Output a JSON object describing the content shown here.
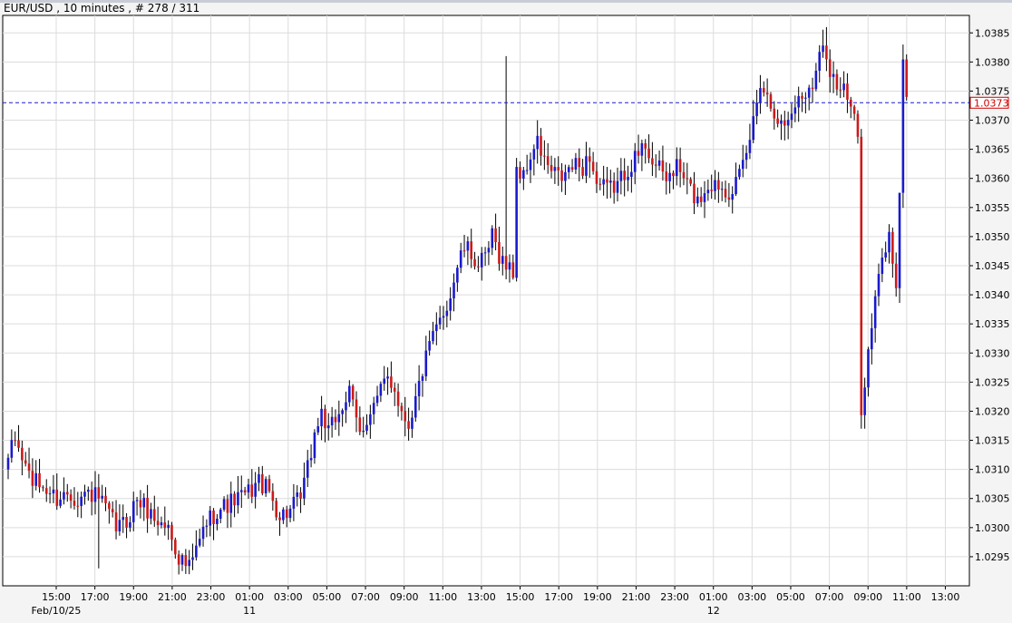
{
  "chart_data": {
    "type": "candlestick",
    "title": "EUR/USD , 10 minutes , # 278 / 311",
    "symbol": "EUR/USD",
    "timeframe": "10 minutes",
    "bar_index": "# 278 / 311",
    "ylim": [
      1.029,
      1.0388
    ],
    "yticks": [
      "1.0385",
      "1.0380",
      "1.0375",
      "1.0370",
      "1.0365",
      "1.0360",
      "1.0355",
      "1.0350",
      "1.0345",
      "1.0340",
      "1.0335",
      "1.0330",
      "1.0325",
      "1.0320",
      "1.0315",
      "1.0310",
      "1.0305",
      "1.0300",
      "1.0295"
    ],
    "xticks": [
      "15:00",
      "17:00",
      "19:00",
      "21:00",
      "23:00",
      "01:00",
      "03:00",
      "05:00",
      "07:00",
      "09:00",
      "11:00",
      "13:00",
      "15:00",
      "17:00",
      "19:00",
      "21:00",
      "23:00",
      "01:00",
      "03:00",
      "05:00",
      "07:00",
      "09:00",
      "11:00",
      "13:00"
    ],
    "date_labels": [
      {
        "label": "Feb/10/25",
        "at_tick": 0
      },
      {
        "label": "11",
        "at_tick": 5
      },
      {
        "label": "12",
        "at_tick": 17
      }
    ],
    "current_price": 1.0373,
    "current_price_label": "1.0373",
    "grid": true,
    "colors": {
      "up": "#1a1acc",
      "down": "#cc1a1a",
      "wick": "#000000",
      "grid": "#dcdcdc",
      "price_line": "#1a1acc",
      "price_label": "#cc0000"
    },
    "anchor_closes": [
      [
        0,
        1.0312
      ],
      [
        2,
        1.0315
      ],
      [
        4,
        1.0312
      ],
      [
        7,
        1.0308
      ],
      [
        10,
        1.0307
      ],
      [
        14,
        1.0305
      ],
      [
        17,
        1.0306
      ],
      [
        20,
        1.0305
      ],
      [
        23,
        1.0306
      ],
      [
        26,
        1.0305
      ],
      [
        29,
        1.0302
      ],
      [
        31,
        1.03
      ],
      [
        34,
        1.0301
      ],
      [
        37,
        1.0305
      ],
      [
        40,
        1.0303
      ],
      [
        43,
        1.0301
      ],
      [
        46,
        1.03
      ],
      [
        49,
        1.0295
      ],
      [
        52,
        1.0293
      ],
      [
        54,
        1.0296
      ],
      [
        57,
        1.0301
      ],
      [
        60,
        1.0303
      ],
      [
        63,
        1.0304
      ],
      [
        66,
        1.0305
      ],
      [
        69,
        1.0306
      ],
      [
        72,
        1.0308
      ],
      [
        75,
        1.0306
      ],
      [
        78,
        1.0302
      ],
      [
        81,
        1.0303
      ],
      [
        84,
        1.0305
      ],
      [
        86,
        1.031
      ],
      [
        88,
        1.0316
      ],
      [
        90,
        1.032
      ],
      [
        92,
        1.0316
      ],
      [
        95,
        1.032
      ],
      [
        98,
        1.0323
      ],
      [
        101,
        1.0316
      ],
      [
        103,
        1.0319
      ],
      [
        106,
        1.0322
      ],
      [
        109,
        1.0326
      ],
      [
        111,
        1.0324
      ],
      [
        113,
        1.032
      ],
      [
        115,
        1.0318
      ],
      [
        117,
        1.0322
      ],
      [
        119,
        1.0327
      ],
      [
        121,
        1.0331
      ],
      [
        123,
        1.0334
      ],
      [
        125,
        1.0337
      ],
      [
        127,
        1.034
      ],
      [
        129,
        1.0345
      ],
      [
        131,
        1.0348
      ],
      [
        133,
        1.0347
      ],
      [
        135,
        1.0345
      ],
      [
        137,
        1.0346
      ],
      [
        139,
        1.035
      ],
      [
        141,
        1.0347
      ],
      [
        143,
        1.0345
      ],
      [
        145,
        1.0344
      ],
      [
        146,
        1.0362
      ],
      [
        148,
        1.036
      ],
      [
        150,
        1.0364
      ],
      [
        152,
        1.0366
      ],
      [
        154,
        1.0363
      ],
      [
        156,
        1.0361
      ],
      [
        159,
        1.036
      ],
      [
        162,
        1.0362
      ],
      [
        165,
        1.0362
      ],
      [
        167,
        1.0364
      ],
      [
        169,
        1.0359
      ],
      [
        172,
        1.0358
      ],
      [
        175,
        1.0359
      ],
      [
        178,
        1.0362
      ],
      [
        181,
        1.0364
      ],
      [
        183,
        1.0366
      ],
      [
        186,
        1.0362
      ],
      [
        189,
        1.036
      ],
      [
        192,
        1.0362
      ],
      [
        195,
        1.0359
      ],
      [
        198,
        1.0356
      ],
      [
        201,
        1.0359
      ],
      [
        204,
        1.0359
      ],
      [
        207,
        1.0358
      ],
      [
        210,
        1.036
      ],
      [
        212,
        1.0364
      ],
      [
        214,
        1.037
      ],
      [
        216,
        1.0377
      ],
      [
        218,
        1.0374
      ],
      [
        220,
        1.0372
      ],
      [
        222,
        1.0369
      ],
      [
        224,
        1.037
      ],
      [
        226,
        1.0373
      ],
      [
        228,
        1.0374
      ],
      [
        230,
        1.0376
      ],
      [
        232,
        1.0378
      ],
      [
        234,
        1.0384
      ],
      [
        236,
        1.0379
      ],
      [
        238,
        1.0376
      ],
      [
        240,
        1.0375
      ],
      [
        242,
        1.0372
      ],
      [
        244,
        1.0367
      ],
      [
        245,
        1.0321
      ],
      [
        247,
        1.033
      ],
      [
        249,
        1.0339
      ],
      [
        251,
        1.0346
      ],
      [
        253,
        1.035
      ],
      [
        255,
        1.0342
      ],
      [
        256,
        1.0358
      ],
      [
        257,
        1.0379
      ],
      [
        258,
        1.0374
      ]
    ]
  }
}
